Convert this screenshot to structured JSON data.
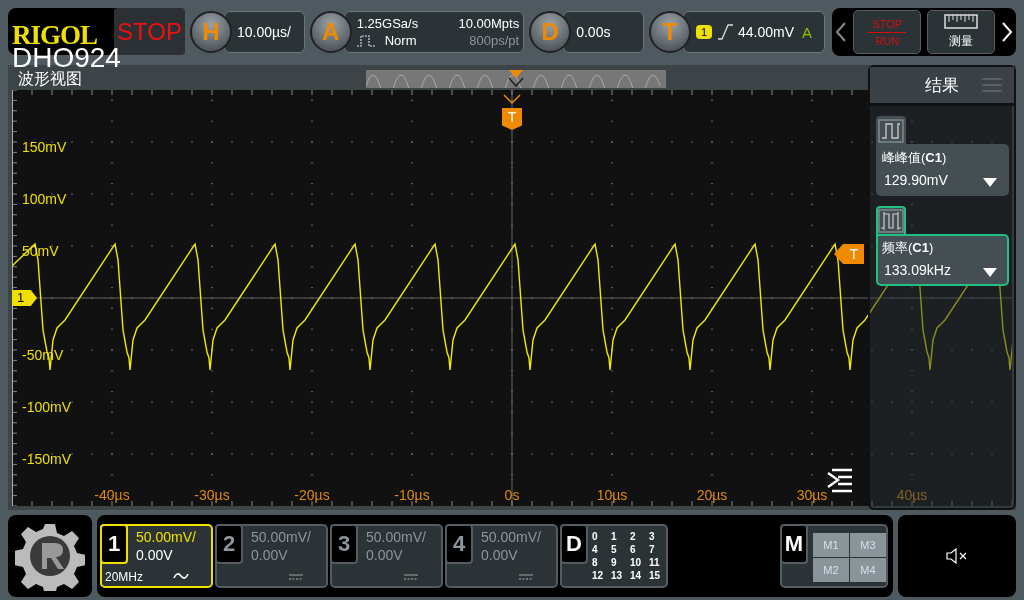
{
  "logo": "RIGOL",
  "run_state": "STOP",
  "model": "DHO924",
  "horizontal": {
    "letter": "H",
    "scale": "10.00µs/"
  },
  "acquire": {
    "letter": "A",
    "sample_rate": "1.25GSa/s",
    "mode": "Norm",
    "memory_depth": "10.00Mpts",
    "resolution": "800ps/pt"
  },
  "delay": {
    "letter": "D",
    "offset": "0.00s"
  },
  "trigger": {
    "letter": "T",
    "source": "1",
    "level": "44.00mV",
    "sweep": "A"
  },
  "controls": [
    {
      "kind": "run_stop",
      "label_top": "STOP",
      "label_bottom": "RUN"
    },
    {
      "kind": "measure",
      "label": "测量"
    }
  ],
  "waveform_view": {
    "title": "波形视图",
    "channel_marker": "1",
    "trigger_marker": "T",
    "trigger_level_marker": "T",
    "y_labels": [
      "150mV",
      "100mV",
      "50mV",
      "-50mV",
      "-100mV",
      "-150mV"
    ],
    "x_labels": [
      "-40µs",
      "-30µs",
      "-20µs",
      "-10µs",
      "0s",
      "10µs",
      "20µs",
      "30µs",
      "40µs"
    ]
  },
  "results": {
    "title": "结果",
    "items": [
      {
        "kind": "peak_to_peak",
        "label": "峰峰值(**C1**)",
        "value": "129.90mV",
        "selected": false
      },
      {
        "kind": "frequency",
        "label": "频率(**C1**)",
        "value": "133.09kHz",
        "selected": true
      }
    ]
  },
  "channels": [
    {
      "kind": "ac",
      "number": "1",
      "scale": "50.00mV/",
      "offset": "0.00V",
      "bandwidth": "20MHz",
      "active": true
    },
    {
      "kind": "dc",
      "number": "2",
      "scale": "50.00mV/",
      "offset": "0.00V",
      "active": false
    },
    {
      "kind": "dc",
      "number": "3",
      "scale": "50.00mV/",
      "offset": "0.00V",
      "active": false
    },
    {
      "kind": "dc",
      "number": "4",
      "scale": "50.00mV/",
      "offset": "0.00V",
      "active": false
    }
  ],
  "digital": {
    "letter": "D",
    "bits": [
      "0",
      "1",
      "2",
      "3",
      "4",
      "5",
      "6",
      "7",
      "8",
      "9",
      "10",
      "11",
      "12",
      "13",
      "14",
      "15"
    ]
  },
  "math": {
    "letter": "M",
    "items": [
      "M1",
      "M3",
      "M2",
      "M4"
    ]
  }
}
